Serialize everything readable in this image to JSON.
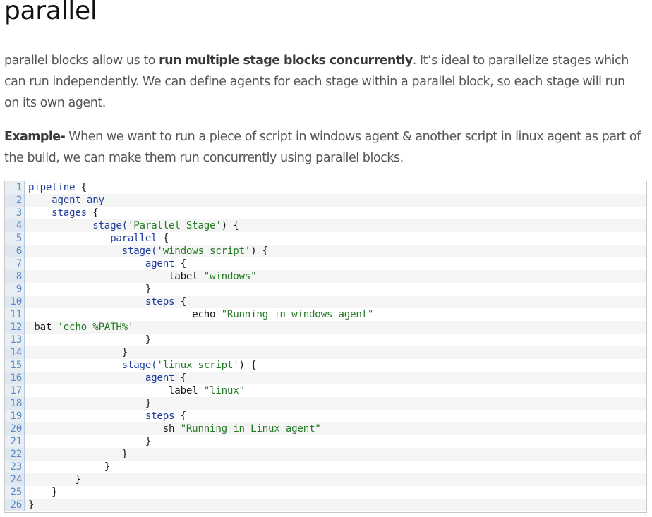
{
  "heading": "parallel",
  "paragraph1": {
    "before": "parallel blocks allow us to ",
    "bold": "run multiple stage blocks concurrently",
    "after": ". It’s ideal to parallelize stages which can run independently. We can define agents for each stage within a parallel block, so each stage will run on its own agent."
  },
  "paragraph2": {
    "bold": "Example-",
    "after": " When we want to run a piece of script in windows agent & another script in linux agent as part of the build, we can make them run concurrently using parallel blocks."
  },
  "code": {
    "lines": [
      {
        "n": "1",
        "segs": [
          {
            "t": "pipeline",
            "c": "kw"
          },
          {
            "t": " {",
            "c": "plain"
          }
        ]
      },
      {
        "n": "2",
        "segs": [
          {
            "t": "    ",
            "c": "plain"
          },
          {
            "t": "agent any",
            "c": "kw"
          }
        ]
      },
      {
        "n": "3",
        "segs": [
          {
            "t": "    ",
            "c": "plain"
          },
          {
            "t": "stages",
            "c": "kw"
          },
          {
            "t": " {",
            "c": "plain"
          }
        ]
      },
      {
        "n": "4",
        "segs": [
          {
            "t": "           ",
            "c": "plain"
          },
          {
            "t": "stage(",
            "c": "kw"
          },
          {
            "t": "'Parallel Stage'",
            "c": "str"
          },
          {
            "t": ") {",
            "c": "plain"
          }
        ]
      },
      {
        "n": "5",
        "segs": [
          {
            "t": "              ",
            "c": "plain"
          },
          {
            "t": "parallel",
            "c": "kw"
          },
          {
            "t": " {",
            "c": "plain"
          }
        ]
      },
      {
        "n": "6",
        "segs": [
          {
            "t": "                ",
            "c": "plain"
          },
          {
            "t": "stage(",
            "c": "kw"
          },
          {
            "t": "'windows script'",
            "c": "str"
          },
          {
            "t": ") {",
            "c": "plain"
          }
        ]
      },
      {
        "n": "7",
        "segs": [
          {
            "t": "                    ",
            "c": "plain"
          },
          {
            "t": "agent",
            "c": "kw"
          },
          {
            "t": " {",
            "c": "plain"
          }
        ]
      },
      {
        "n": "8",
        "segs": [
          {
            "t": "                        label ",
            "c": "plain"
          },
          {
            "t": "\"windows\"",
            "c": "str"
          }
        ]
      },
      {
        "n": "9",
        "segs": [
          {
            "t": "                    }",
            "c": "plain"
          }
        ]
      },
      {
        "n": "10",
        "segs": [
          {
            "t": "                    ",
            "c": "plain"
          },
          {
            "t": "steps",
            "c": "kw"
          },
          {
            "t": " {",
            "c": "plain"
          }
        ]
      },
      {
        "n": "11",
        "segs": [
          {
            "t": "                            echo ",
            "c": "plain"
          },
          {
            "t": "\"Running in windows agent\"",
            "c": "str"
          }
        ]
      },
      {
        "n": "12",
        "segs": [
          {
            "t": " bat ",
            "c": "plain"
          },
          {
            "t": "'echo %PATH%'",
            "c": "str"
          }
        ]
      },
      {
        "n": "13",
        "segs": [
          {
            "t": "                    }",
            "c": "plain"
          }
        ]
      },
      {
        "n": "14",
        "segs": [
          {
            "t": "                }",
            "c": "plain"
          }
        ]
      },
      {
        "n": "15",
        "segs": [
          {
            "t": "                ",
            "c": "plain"
          },
          {
            "t": "stage(",
            "c": "kw"
          },
          {
            "t": "'linux script'",
            "c": "str"
          },
          {
            "t": ") {",
            "c": "plain"
          }
        ]
      },
      {
        "n": "16",
        "segs": [
          {
            "t": "                    ",
            "c": "plain"
          },
          {
            "t": "agent",
            "c": "kw"
          },
          {
            "t": " {",
            "c": "plain"
          }
        ]
      },
      {
        "n": "17",
        "segs": [
          {
            "t": "                        label ",
            "c": "plain"
          },
          {
            "t": "\"linux\"",
            "c": "str"
          }
        ]
      },
      {
        "n": "18",
        "segs": [
          {
            "t": "                    }",
            "c": "plain"
          }
        ]
      },
      {
        "n": "19",
        "segs": [
          {
            "t": "                    ",
            "c": "plain"
          },
          {
            "t": "steps",
            "c": "kw"
          },
          {
            "t": " {",
            "c": "plain"
          }
        ]
      },
      {
        "n": "20",
        "segs": [
          {
            "t": "                       sh ",
            "c": "plain"
          },
          {
            "t": "\"Running in Linux agent\"",
            "c": "str"
          }
        ]
      },
      {
        "n": "21",
        "segs": [
          {
            "t": "                    }",
            "c": "plain"
          }
        ]
      },
      {
        "n": "22",
        "segs": [
          {
            "t": "                }",
            "c": "plain"
          }
        ]
      },
      {
        "n": "23",
        "segs": [
          {
            "t": "             }",
            "c": "plain"
          }
        ]
      },
      {
        "n": "24",
        "segs": [
          {
            "t": "        }",
            "c": "plain"
          }
        ]
      },
      {
        "n": "25",
        "segs": [
          {
            "t": "    }",
            "c": "plain"
          }
        ]
      },
      {
        "n": "26",
        "segs": [
          {
            "t": "}",
            "c": "plain"
          }
        ]
      }
    ]
  }
}
